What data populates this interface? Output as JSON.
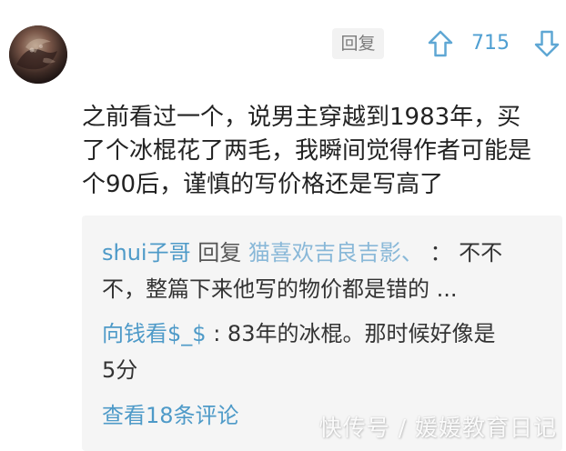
{
  "comment": {
    "reply_label": "回复",
    "vote_count": "715",
    "lines": [
      "之前看过一个，说男主穿越到1983年，买",
      "了个冰棍花了两毛，我瞬间觉得作者可能是",
      "个90后，谨慎的写价格还是写高了"
    ]
  },
  "replies": {
    "first": {
      "username": "shui子哥",
      "reply_word": "回复",
      "target": "猫喜欢吉良吉影、",
      "separator": "：",
      "text_line1": "不不",
      "text_line2": "不，整篇下来他写的物价都是错的 ..."
    },
    "second": {
      "username": "向钱看$_$",
      "separator": ":",
      "text_line1": "83年的冰棍。那时候好像是",
      "text_line2": "5分"
    },
    "view_more": "查看18条评论"
  },
  "watermark": "快传号 / 媛媛教育日记",
  "colors": {
    "accent": "#4e9ac8",
    "vote": "#4f9fd2",
    "background": "#ffffff",
    "reply_box": "#f5f5f5"
  },
  "icons": {
    "up": "arrow-up-icon",
    "down": "arrow-down-icon",
    "avatar": "avatar"
  }
}
